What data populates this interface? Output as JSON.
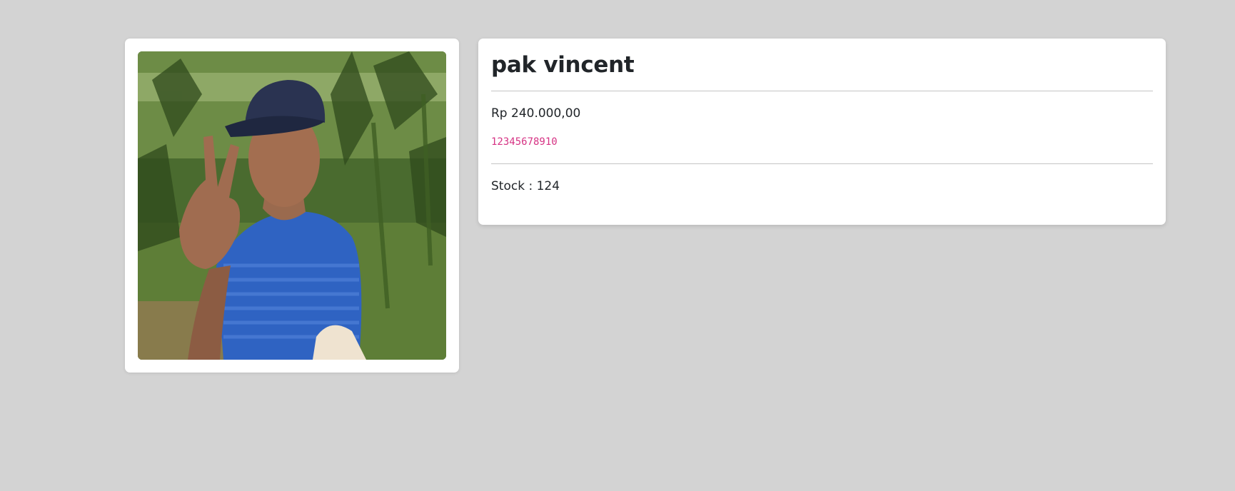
{
  "product": {
    "name": "pak vincent",
    "price": "Rp 240.000,00",
    "code": "12345678910",
    "stock_label": "Stock : 124",
    "stock": 124,
    "image_description": "photo-of-person"
  },
  "colors": {
    "background": "#d3d3d3",
    "card": "#ffffff",
    "code_text": "#d63384",
    "text": "#212529"
  }
}
